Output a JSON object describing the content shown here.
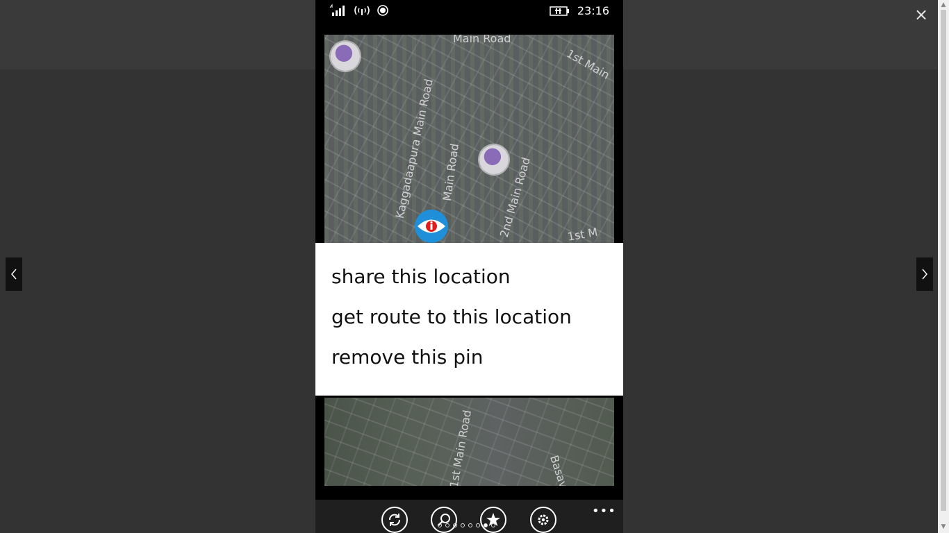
{
  "viewer": {
    "close_label": "×",
    "prev_label": "previous",
    "next_label": "next"
  },
  "status_bar": {
    "time": "23:16",
    "icons": [
      "signal-icon",
      "wifi-icon",
      "location-icon",
      "battery-icon"
    ]
  },
  "map": {
    "top_labels": [
      "Main Road",
      "1st Main",
      "Kaggadaapura Main Road",
      "Main Road",
      "2nd Main Road",
      "1st M"
    ],
    "bottom_labels": [
      "1st Main Road",
      "Basav"
    ]
  },
  "context_menu": {
    "items": [
      {
        "label": "share this location"
      },
      {
        "label": "get route to this location"
      },
      {
        "label": "remove this pin"
      }
    ]
  },
  "app_bar": {
    "buttons": [
      "refresh-icon",
      "search-icon",
      "favorites-icon",
      "settings-icon"
    ],
    "more_label": "•••",
    "page_dots": 8,
    "active_dot": 6
  },
  "colors": {
    "pin_blue": "#1e8fd8",
    "pin_red": "#e21b1b",
    "menu_bg": "#ffffff",
    "app_bar_bg": "#1f1f1f"
  }
}
